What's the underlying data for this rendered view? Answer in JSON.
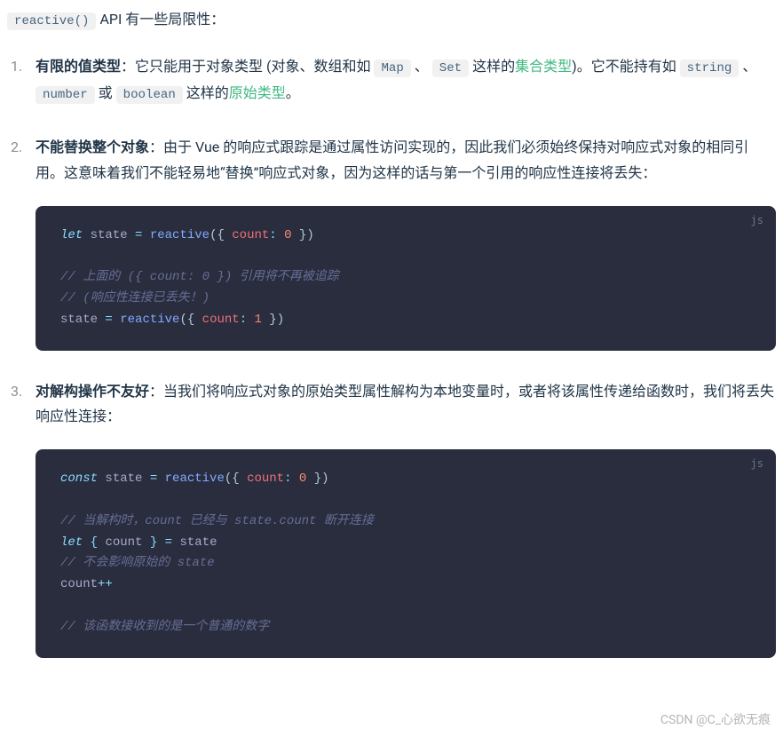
{
  "intro": {
    "code": "reactive()",
    "tail": " API 有一些局限性："
  },
  "items": [
    {
      "title": "有限的值类型",
      "colon": "：",
      "seg1": "它只能用于对象类型 (对象、数组和如 ",
      "code1": "Map",
      "seg2": " 、 ",
      "code2": "Set",
      "seg3": " 这样的",
      "link1": "集合类型",
      "seg4": ")。它不能持有如 ",
      "code3": "string",
      "seg5": " 、 ",
      "code4": "number",
      "seg6": " 或 ",
      "code5": "boolean",
      "seg7": " 这样的",
      "link2": "原始类型",
      "seg8": "。"
    },
    {
      "title": "不能替换整个对象",
      "colon": "：",
      "text": "由于 Vue 的响应式跟踪是通过属性访问实现的，因此我们必须始终保持对响应式对象的相同引用。这意味着我们不能轻易地“替换”响应式对象，因为这样的话与第一个引用的响应性连接将丢失：",
      "code": {
        "lang": "js",
        "l1": {
          "kw": "let",
          "name": " state ",
          "eq": "= ",
          "fn": "reactive",
          "p1": "({ ",
          "prop": "count",
          "colon": ":",
          "sp": " ",
          "num": "0",
          "p2": " })"
        },
        "c1": "// 上面的 ({ count: 0 }) 引用将不再被追踪",
        "c2": "// (响应性连接已丢失！)",
        "l2": {
          "name": "state ",
          "eq": "= ",
          "fn": "reactive",
          "p1": "({ ",
          "prop": "count",
          "colon": ":",
          "sp": " ",
          "num": "1",
          "p2": " })"
        }
      }
    },
    {
      "title": "对解构操作不友好",
      "colon": "：",
      "text": "当我们将响应式对象的原始类型属性解构为本地变量时，或者将该属性传递给函数时，我们将丢失响应性连接：",
      "code": {
        "lang": "js",
        "l1": {
          "kw": "const",
          "name": " state ",
          "eq": "= ",
          "fn": "reactive",
          "p1": "({ ",
          "prop": "count",
          "colon": ":",
          "sp": " ",
          "num": "0",
          "p2": " })"
        },
        "c1": "// 当解构时，count 已经与 state.count 断开连接",
        "l2": {
          "kw": "let",
          "sp1": " ",
          "b1": "{",
          "sp2": " ",
          "name": "count",
          "sp3": " ",
          "b2": "}",
          "sp4": " ",
          "eq": "=",
          "sp5": " ",
          "src": "state"
        },
        "c2": "// 不会影响原始的 state",
        "l3": {
          "name": "count",
          "op": "++"
        },
        "c3": "// 该函数接收到的是一个普通的数字"
      }
    }
  ],
  "watermark": "CSDN @C_心欲无痕"
}
